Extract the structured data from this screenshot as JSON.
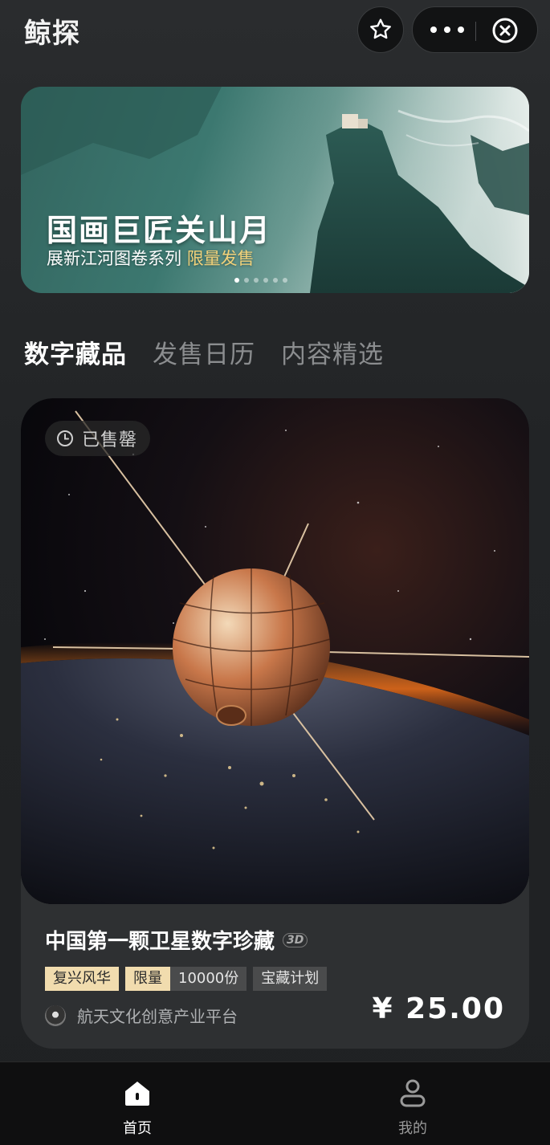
{
  "header": {
    "app_title": "鲸探",
    "icons": {
      "favorite": "star-icon",
      "more": "more-dots-icon",
      "close": "close-circle-icon"
    }
  },
  "banner": {
    "title": "国画巨匠关山月",
    "subtitle_prefix": "展新江河图卷系列 ",
    "subtitle_highlight": "限量发售",
    "highlight_color": "#f2d27a",
    "slide_count": 6,
    "active_slide": 1
  },
  "tabs": [
    {
      "label": "数字藏品",
      "active": true
    },
    {
      "label": "发售日历",
      "active": false
    },
    {
      "label": "内容精选",
      "active": false
    }
  ],
  "card": {
    "status": "已售罄",
    "status_icon": "clock-icon",
    "title": "中国第一颗卫星数字珍藏",
    "badge_3d": "3D",
    "tags": {
      "series": "复兴风华",
      "limit_label": "限量",
      "limit_count": "10000份",
      "program": "宝藏计划"
    },
    "publisher": "航天文化创意产业平台",
    "price": "¥ 25.00"
  },
  "bottom_nav": [
    {
      "label": "首页",
      "icon": "home-icon",
      "active": true
    },
    {
      "label": "我的",
      "icon": "user-icon",
      "active": false
    }
  ]
}
